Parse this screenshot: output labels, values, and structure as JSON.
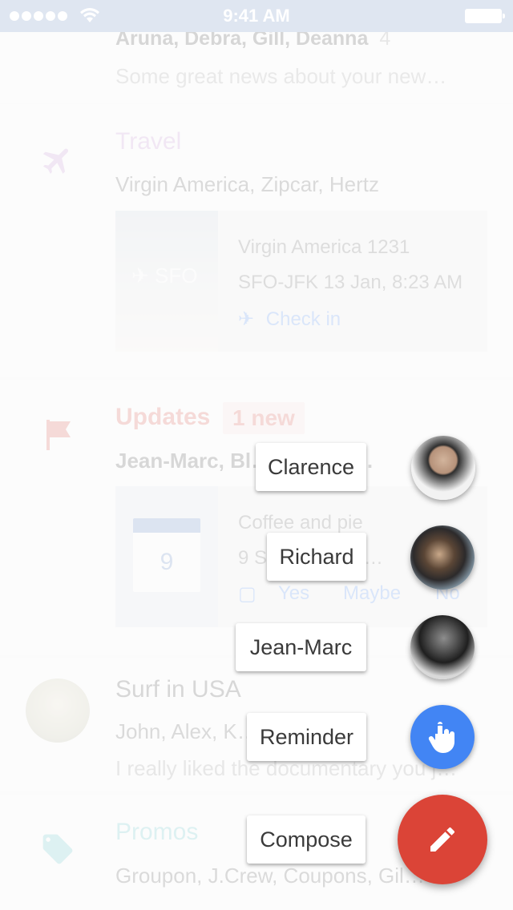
{
  "status_bar": {
    "time": "9:41 AM"
  },
  "inbox": {
    "first_item": {
      "senders": "Aruna, Debra, Gill, Deanna",
      "count": "4",
      "snippet": "Some great news about your new…"
    },
    "travel": {
      "title": "Travel",
      "title_color": "#c58ad6",
      "icon": "airplane-icon",
      "senders": "Virgin America, Zipcar, Hertz",
      "card": {
        "thumb_label": "✈ SFO",
        "flight": "Virgin America 1231",
        "route": "SFO-JFK 13 Jan, 8:23 AM",
        "action": "Check in"
      }
    },
    "updates": {
      "title": "Updates",
      "title_color": "#db4437",
      "icon": "flag-icon",
      "badge": "1 new",
      "senders": "Jean-Marc, Bl… …or, Ja…",
      "card": {
        "calendar_day": "9",
        "event": "Coffee and pie",
        "time": "9 S… …M - 11…",
        "rsvp": [
          "Yes",
          "Maybe",
          "No"
        ]
      }
    },
    "surf": {
      "title": "Surf in USA",
      "senders": "John, Alex, K…",
      "snippet": "I really liked the documentary you j…"
    },
    "promos": {
      "title": "Promos",
      "title_color": "#56c1c9",
      "icon": "tag-icon",
      "senders": "Groupon, J.Crew, Coupons, Gil…"
    }
  },
  "speed_dial": {
    "clarence": {
      "label": "Clarence"
    },
    "richard": {
      "label": "Richard"
    },
    "jean_marc": {
      "label": "Jean-Marc"
    },
    "reminder": {
      "label": "Reminder",
      "icon": "reminder-finger-icon",
      "color": "#4285f4"
    },
    "compose": {
      "label": "Compose",
      "icon": "pencil-icon",
      "color": "#db4437"
    }
  }
}
